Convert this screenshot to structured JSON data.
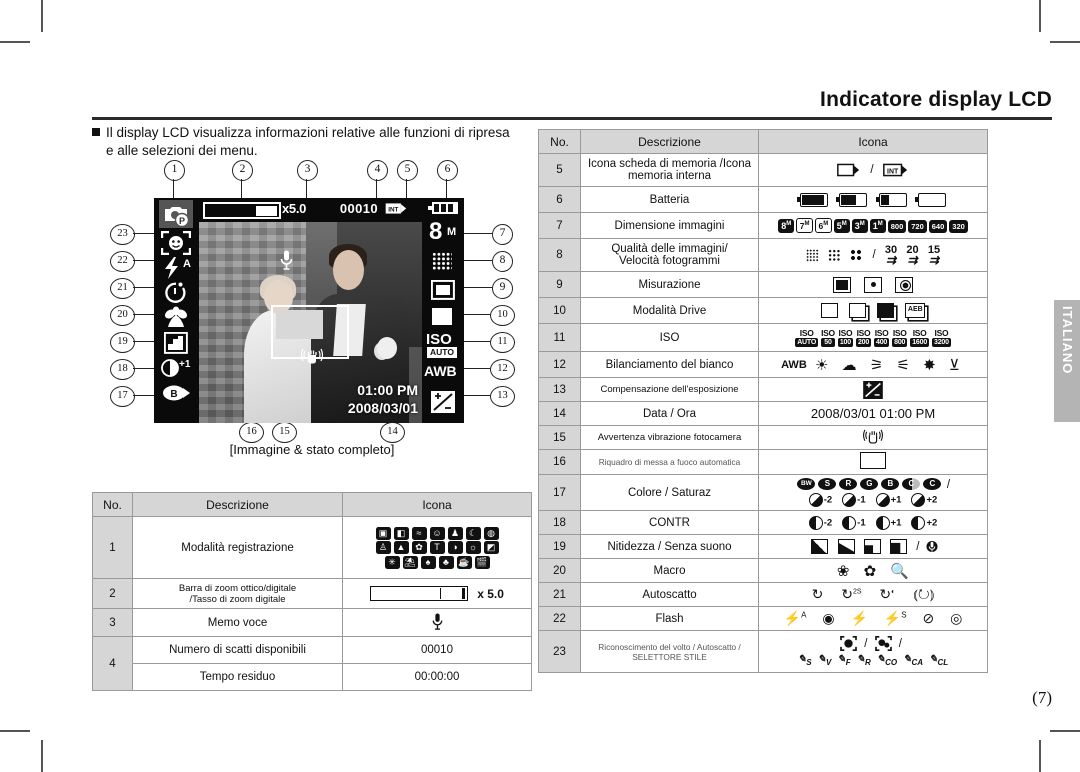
{
  "document": {
    "title": "Indicatore display LCD",
    "page_number": "(7)",
    "language_tab": "ITALIANO",
    "intro_line1": "Il display LCD visualizza informazioni relative alle funzioni di ripresa",
    "intro_line2": "e alle selezioni dei menu.",
    "figure_caption": "[Immagine & stato completo]"
  },
  "lcd": {
    "zoom_rate": "x5.0",
    "shots_remaining": "00010",
    "memory_icon": "internal-memory-icon",
    "battery_icon": "battery-full-icon",
    "image_size": "8",
    "image_size_unit": "M",
    "quality_icon": "superfine-quality-icon",
    "metering_icon": "spot-metering-icon",
    "drive_icon": "single-shot-icon",
    "iso_label": "ISO",
    "iso_value": "AUTO",
    "white_balance": "AWB",
    "exposure_icon": "exposure-compensation-icon",
    "time": "01:00 PM",
    "date": "2008/03/01",
    "mode_icon": "program-mode-icon",
    "face_detect_icon": "face-detection-icon",
    "flash_icon": "flash-auto-icon",
    "timer_icon": "self-timer-icon",
    "macro_icon": "macro-icon",
    "sharpness_icon": "sharpness-icon",
    "contrast_icon": "contrast-plus1-icon",
    "contrast_label": "+1",
    "color_icon": "color-b-icon",
    "color_label": "B",
    "voice_memo_icon": "microphone-icon",
    "shake_warning_icon": "camera-shake-icon",
    "af_frame_icon": "auto-focus-frame",
    "callouts": [
      "1",
      "2",
      "3",
      "4",
      "5",
      "6",
      "7",
      "8",
      "9",
      "10",
      "11",
      "12",
      "13",
      "14",
      "15",
      "16",
      "17",
      "18",
      "19",
      "20",
      "21",
      "22",
      "23"
    ]
  },
  "table_headers": {
    "no": "No.",
    "descrizione": "Descrizione",
    "icona": "Icona"
  },
  "table_left": [
    {
      "no": "1",
      "desc": "Modalità registrazione",
      "icon_kind": "mode-grid"
    },
    {
      "no": "2",
      "desc": "Barra di zoom ottico/digitale",
      "desc2": "/Tasso di zoom digitale",
      "icon_kind": "zoom-bar",
      "icon_text": "x 5.0"
    },
    {
      "no": "3",
      "desc": "Memo voce",
      "icon_kind": "mic"
    },
    {
      "no": "4",
      "desc": "Numero di scatti disponibili",
      "icon_kind": "text",
      "icon_text": "00010"
    },
    {
      "no": "",
      "desc": "Tempo residuo",
      "icon_kind": "text",
      "icon_text": "00:00:00"
    }
  ],
  "table_right": [
    {
      "no": "5",
      "desc": "Icona scheda di memoria /Icona",
      "desc2": "memoria interna",
      "icon_kind": "memory"
    },
    {
      "no": "6",
      "desc": "Batteria",
      "icon_kind": "battery"
    },
    {
      "no": "7",
      "desc": "Dimensione immagini",
      "icon_kind": "sizes",
      "sizes": [
        "8",
        "7",
        "6",
        "5",
        "3",
        "1",
        "800",
        "720",
        "640",
        "320"
      ]
    },
    {
      "no": "8",
      "desc": "Qualità delle immagini/",
      "desc2": "Velocità fotogrammi",
      "icon_kind": "quality",
      "fps": [
        "30",
        "20",
        "15"
      ]
    },
    {
      "no": "9",
      "desc": "Misurazione",
      "icon_kind": "metering"
    },
    {
      "no": "10",
      "desc": "Modalità Drive",
      "icon_kind": "drive",
      "aeb_label": "AEB"
    },
    {
      "no": "11",
      "desc": "ISO",
      "icon_kind": "iso",
      "iso_values": [
        "AUTO",
        "50",
        "100",
        "200",
        "400",
        "800",
        "1600",
        "3200"
      ]
    },
    {
      "no": "12",
      "desc": "Bilanciamento del bianco",
      "icon_kind": "wb",
      "awb_label": "AWB"
    },
    {
      "no": "13",
      "desc": "Compensazione dell'esposizione",
      "icon_kind": "ev",
      "small_desc": true
    },
    {
      "no": "14",
      "desc": "Data / Ora",
      "icon_kind": "text",
      "icon_text": "2008/03/01  01:00 PM"
    },
    {
      "no": "15",
      "desc": "Avvertenza vibrazione fotocamera",
      "icon_kind": "shake",
      "small_desc": true
    },
    {
      "no": "16",
      "desc": "Riquadro di messa a fuoco automatica",
      "icon_kind": "afframe",
      "xsmall_desc": true
    },
    {
      "no": "17",
      "desc": "Colore / Saturaz",
      "icon_kind": "color",
      "color_dots": [
        "BW",
        "S",
        "R",
        "G",
        "B",
        "C",
        "C"
      ],
      "sat_values": [
        "-2",
        "-1",
        "+1",
        "+2"
      ]
    },
    {
      "no": "18",
      "desc": "CONTR",
      "icon_kind": "contr",
      "contr_values": [
        "-2",
        "-1",
        "+1",
        "+2"
      ]
    },
    {
      "no": "19",
      "desc": "Nitidezza / Senza suono",
      "icon_kind": "sharp"
    },
    {
      "no": "20",
      "desc": "Macro",
      "icon_kind": "macro"
    },
    {
      "no": "21",
      "desc": "Autoscatto",
      "icon_kind": "timer"
    },
    {
      "no": "22",
      "desc": "Flash",
      "icon_kind": "flash"
    },
    {
      "no": "23",
      "desc": "Riconoscimento del volto / Autoscatto /",
      "desc2": "SELETTORE STILE",
      "icon_kind": "style",
      "style_labels": [
        "S",
        "V",
        "F",
        "R",
        "CO",
        "CA",
        "CL"
      ],
      "xsmall_desc": true
    }
  ]
}
